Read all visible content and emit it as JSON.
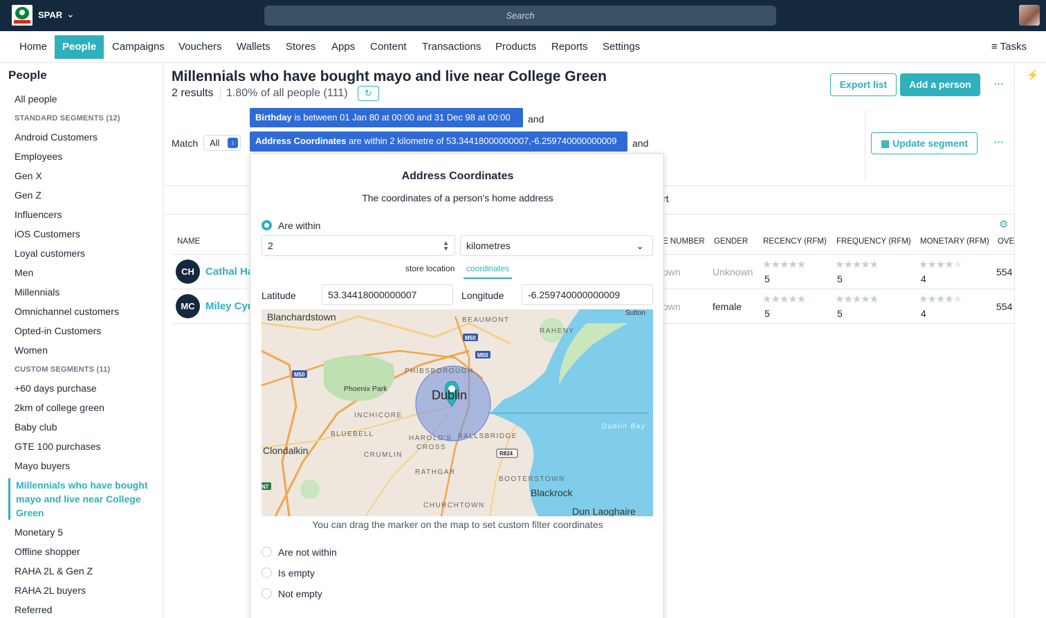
{
  "topbar": {
    "brand": "SPAR",
    "logo_text": "SPAR",
    "search_placeholder": "Search"
  },
  "nav": {
    "items": [
      "Home",
      "People",
      "Campaigns",
      "Vouchers",
      "Wallets",
      "Stores",
      "Apps",
      "Content",
      "Transactions",
      "Products",
      "Reports",
      "Settings"
    ],
    "active": "People",
    "tasks": "Tasks"
  },
  "sidebar": {
    "title": "People",
    "all_people": "All people",
    "standard_header": "STANDARD SEGMENTS (12)",
    "standard": [
      "Android Customers",
      "Employees",
      "Gen X",
      "Gen Z",
      "Influencers",
      "iOS Customers",
      "Loyal customers",
      "Men",
      "Millennials",
      "Omnichannel customers",
      "Opted-in Customers",
      "Women"
    ],
    "custom_header": "CUSTOM SEGMENTS (11)",
    "custom_before": [
      "+60 days purchase",
      "2km of college green",
      "Baby club",
      "GTE 100 purchases",
      "Mayo buyers"
    ],
    "custom_active": "Millennials who have bought mayo and live near College Green",
    "custom_after": [
      "Monetary 5",
      "Offline shopper",
      "RAHA 2L & Gen Z",
      "RAHA 2L buyers",
      "Referred"
    ]
  },
  "header": {
    "title": "Millennials who have bought mayo and live near College Green",
    "results": "2 results",
    "percent": "1.80% of all people (111)",
    "export": "Export list",
    "add_person": "Add a person",
    "update_segment": "Update segment",
    "more": "···"
  },
  "filters": {
    "match_label": "Match",
    "match_value": "All",
    "chip1_bold": "Birthday",
    "chip1_rest": " is between 01 Jan 80 at 00:00 and 31 Dec 98 at 00:00",
    "chip2_bold": "Address Coordinates",
    "chip2_rest": " are within 2 kilometre of 53.34418000000007,-6.259740000000009",
    "and": "and",
    "strip_fragment": "rt"
  },
  "table": {
    "headers": [
      "NAME",
      "E NUMBER",
      "GENDER",
      "RECENCY (RFM)",
      "FREQUENCY (RFM)",
      "MONETARY (RFM)",
      "OVE"
    ],
    "rows": [
      {
        "initials": "CH",
        "name": "Cathal Ha",
        "phone": "own",
        "gender": "Unknown",
        "recency": "5",
        "frequency": "5",
        "monetary": "4",
        "recency_stars": 5,
        "frequency_stars": 5,
        "monetary_stars": 4,
        "overall": "554"
      },
      {
        "initials": "MC",
        "name": "Miley Cyr",
        "phone": "own",
        "gender": "female",
        "recency": "5",
        "frequency": "5",
        "monetary": "4",
        "recency_stars": 5,
        "frequency_stars": 5,
        "monetary_stars": 4,
        "overall": "554"
      }
    ]
  },
  "popup": {
    "title": "Address Coordinates",
    "subtitle": "The coordinates of a person's home address",
    "opt_within": "Are within",
    "distance_value": "2",
    "unit_value": "kilometres",
    "tab_store": "store location",
    "tab_coords": "coordinates",
    "lat_label": "Latitude",
    "lat_value": "53.34418000000007",
    "lng_label": "Longitude",
    "lng_value": "-6.259740000000009",
    "map_hint": "You can drag the marker on the map to set custom filter coordinates",
    "opt_not_within": "Are not within",
    "opt_empty": "Is empty",
    "opt_not_empty": "Not empty",
    "map_labels": {
      "blanchardstown": "Blanchardstown",
      "beaumont": "BEAUMONT",
      "raheny": "RAHENY",
      "sutton": "Sutton",
      "phibsborough": "PHIBSBOROUGH",
      "phoenix": "Phoenix Park",
      "dublin": "Dublin",
      "inchicore": "INCHICORE",
      "bluebell": "BLUEBELL",
      "harolds": "HAROLD'S",
      "cross": "CROSS",
      "ballsbridge": "BALLSBRIDGE",
      "dublin_bay": "Dublin Bay",
      "clondalkin": "Clondalkin",
      "crumlin": "CRUMLIN",
      "rathgar": "RATHGAR",
      "booterstown": "BOOTERSTOWN",
      "blackrock": "Blackrock",
      "churchtown": "CHURCHTOWN",
      "dun_laoghaire": "Dun Laoghaire",
      "m50": "M50",
      "r824": "R824",
      "n7": "N7"
    }
  },
  "colors": {
    "navy": "#14293d",
    "accent": "#2fb0bd",
    "chip_blue": "#2f6bd6",
    "water": "#7fcdea",
    "radius_fill": "#6f8fe0"
  }
}
